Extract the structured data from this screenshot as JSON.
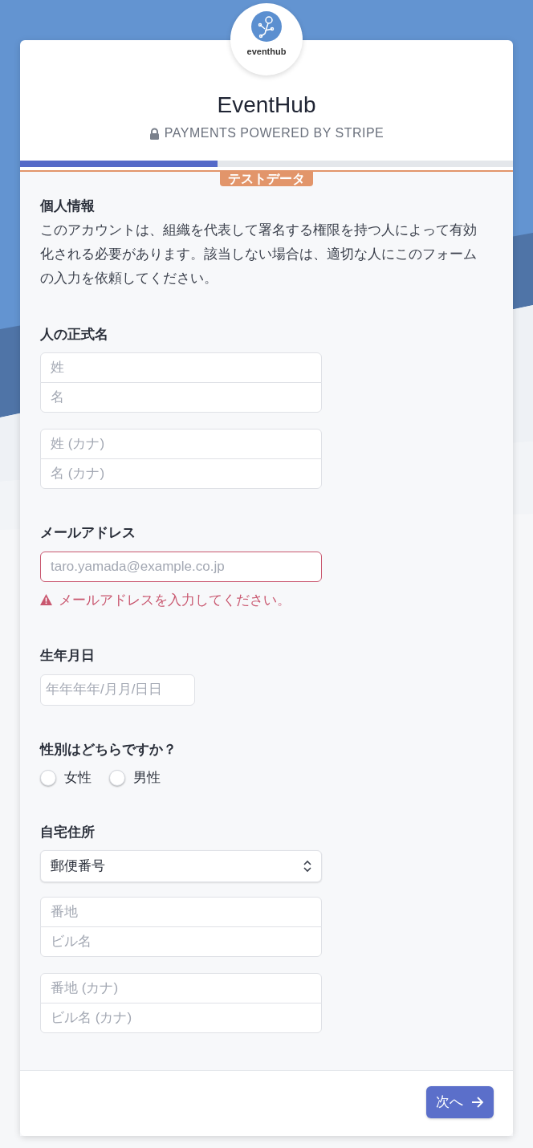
{
  "header": {
    "logo_text": "eventhub",
    "title": "EventHub",
    "subtitle": "PAYMENTS POWERED BY STRIPE"
  },
  "progress": {
    "level": 0.4
  },
  "test_badge": "テストデータ",
  "section": {
    "title": "個人情報",
    "description": "このアカウントは、組織を代表して署名する権限を持つ人によって有効化される必要があります。該当しない場合は、適切な人にこのフォームの入力を依頼してください。"
  },
  "legal_name": {
    "label": "人の正式名",
    "groups": [
      {
        "placeholders": [
          "姓",
          "名"
        ]
      },
      {
        "placeholders": [
          "姓 (カナ)",
          "名 (カナ)"
        ]
      }
    ]
  },
  "email": {
    "label": "メールアドレス",
    "placeholder": "taro.yamada@example.co.jp",
    "invalid": true,
    "error": "メールアドレスを入力してください。"
  },
  "birth_date": {
    "label": "生年月日",
    "placeholder": "年年年年/月月/日日"
  },
  "gender": {
    "label": "性別はどちらですか？",
    "options": [
      {
        "label": "女性",
        "selected": false
      },
      {
        "label": "男性",
        "selected": false
      }
    ]
  },
  "address": {
    "label": "自宅住所",
    "select": "郵便番号",
    "groups": [
      {
        "placeholders": [
          "番地",
          "ビル名"
        ]
      },
      {
        "placeholders": [
          "番地 (カナ)",
          "ビル名 (カナ)"
        ]
      }
    ]
  },
  "footer": {
    "next_button": "次へ"
  }
}
